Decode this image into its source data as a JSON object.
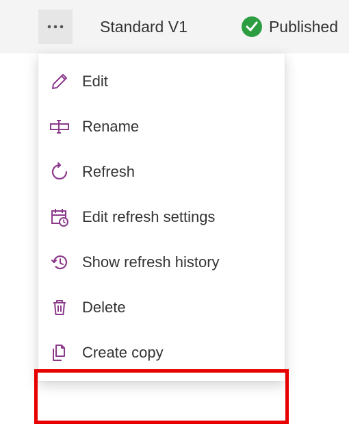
{
  "header": {
    "title": "Standard V1",
    "status_label": "Published"
  },
  "menu": {
    "items": [
      {
        "label": "Edit"
      },
      {
        "label": "Rename"
      },
      {
        "label": "Refresh"
      },
      {
        "label": "Edit refresh settings"
      },
      {
        "label": "Show refresh history"
      },
      {
        "label": "Delete"
      },
      {
        "label": "Create copy"
      }
    ]
  },
  "colors": {
    "icon": "#8b3a8b",
    "success": "#2d9d41"
  }
}
